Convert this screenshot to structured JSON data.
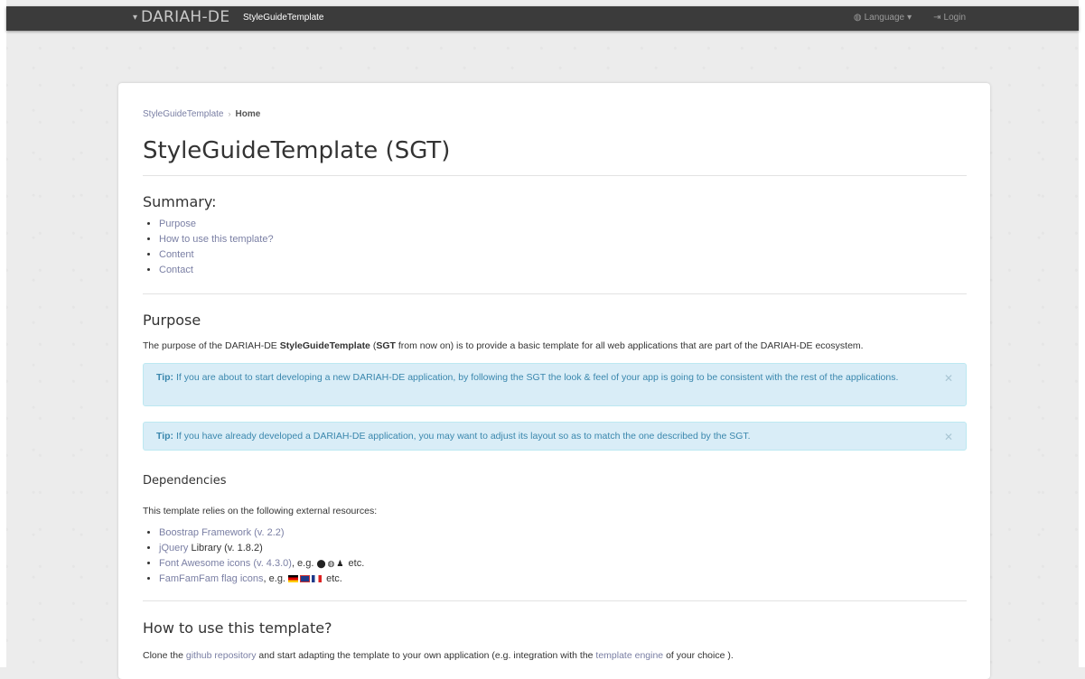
{
  "navbar": {
    "brand": "DARIAH-DE",
    "app_name": "StyleGuideTemplate",
    "language_label": "Language",
    "login_label": "Login"
  },
  "breadcrumb": {
    "root": "StyleGuideTemplate",
    "separator": "›",
    "current": "Home"
  },
  "page_title": "StyleGuideTemplate (SGT)",
  "summary": {
    "heading": "Summary:",
    "items": [
      "Purpose",
      "How to use this template?",
      "Content",
      "Contact"
    ]
  },
  "purpose": {
    "heading": "Purpose",
    "text_1": "The purpose of the DARIAH-DE ",
    "text_bold_1": "StyleGuideTemplate",
    "text_2": " (",
    "text_bold_2": "SGT",
    "text_3": " from now on) is to provide a basic template for all web applications that are part of the DARIAH-DE ecosystem."
  },
  "tips": [
    {
      "label": "Tip:",
      "text": " If you are about to start developing a new DARIAH-DE application, by following the SGT the look & feel of your app is going to be consistent with the rest of the applications."
    },
    {
      "label": "Tip:",
      "text": " If you have already developed a DARIAH-DE application, you may want to adjust its layout so as to match the one described by the SGT."
    }
  ],
  "dependencies": {
    "heading": "Dependencies",
    "intro": "This template relies on the following external resources:",
    "items": [
      {
        "link": "Boostrap Framework (v. 2.2)",
        "rest": ""
      },
      {
        "link": "jQuery",
        "rest": " Library (v. 1.8.2)"
      },
      {
        "link": "Font Awesome icons (v. 4.3.0)",
        "rest": ", e.g. ",
        "suffix": " etc."
      },
      {
        "link": "FamFamFam flag icons",
        "rest": ", e.g. ",
        "suffix": " etc."
      }
    ]
  },
  "how_to": {
    "heading": "How to use this template?",
    "text_1": "Clone the ",
    "link_1": "github repository",
    "text_2": " and start adapting the template to your own application (e.g. integration with the ",
    "link_2": "template engine",
    "text_3": " of your choice )."
  },
  "icons": {
    "brand_caret": "caret-down-icon",
    "language": "globe-icon",
    "login": "sign-in-icon",
    "close": "close-icon",
    "examples": [
      "exclamation-circle-icon",
      "globe-icon",
      "user-icon"
    ],
    "flags": [
      "flag-de-icon",
      "flag-gb-icon",
      "flag-fr-icon"
    ]
  },
  "colors": {
    "navbar_bg": "#3b3b3b",
    "link": "#7a7fa4",
    "alert_bg": "#d9edf7",
    "alert_text": "#3a87ad"
  }
}
